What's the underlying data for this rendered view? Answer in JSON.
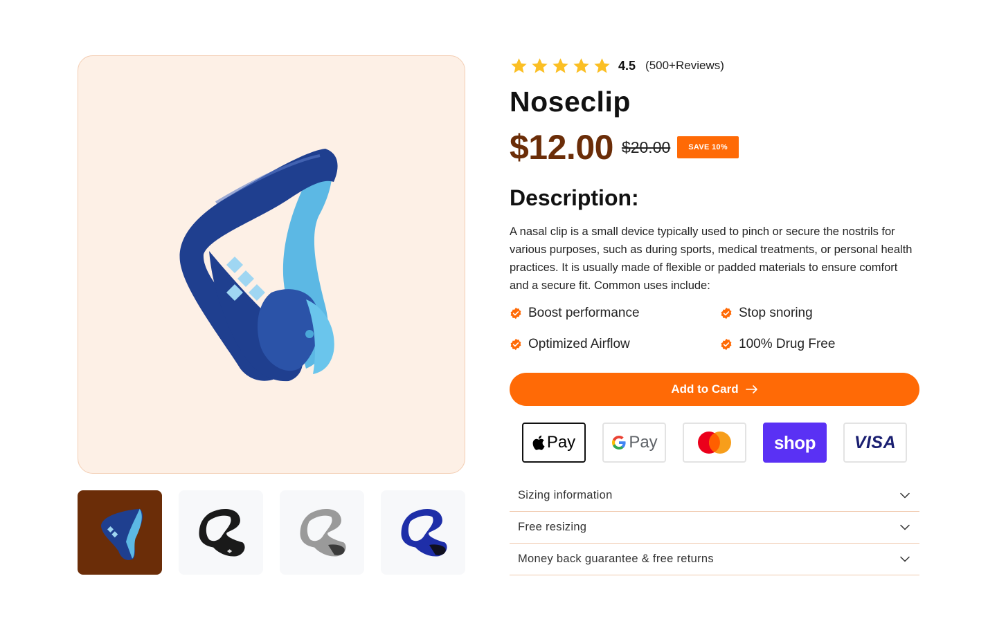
{
  "product": {
    "rating_value": "4.5",
    "rating_count": "(500+Reviews)",
    "stars": 5,
    "title": "Noseclip",
    "price": "$12.00",
    "old_price": "$20.00",
    "save_badge": "SAVE 10%"
  },
  "description": {
    "heading": "Description:",
    "text": "A nasal clip is a small device typically used to pinch or secure the nostrils for various purposes, such as during sports, medical treatments, or personal health practices. It is usually made of flexible or padded materials to ensure comfort and a secure fit. Common uses include:"
  },
  "features": [
    "Boost performance",
    "Stop snoring",
    "Optimized Airflow",
    "100% Drug Free"
  ],
  "cta": {
    "label": "Add to Card"
  },
  "payments": [
    {
      "name": "Apple Pay",
      "text": "Pay"
    },
    {
      "name": "Google Pay",
      "text": "Pay"
    },
    {
      "name": "Mastercard",
      "text": ""
    },
    {
      "name": "Shop Pay",
      "text": "shop"
    },
    {
      "name": "Visa",
      "text": "VISA"
    }
  ],
  "accordion": [
    "Sizing information",
    "Free resizing",
    "Money back guarantee & free returns"
  ],
  "gallery": {
    "thumbnails": [
      "blue-clip",
      "black-clip",
      "gray-clip",
      "navy-clip"
    ],
    "selected_index": 0
  },
  "colors": {
    "accent": "#ff6a06",
    "price": "#6b2d08",
    "hero_bg": "#fdf0e6",
    "star": "#fbbf24",
    "shop_pay": "#5a31f4",
    "visa": "#1a1f71"
  }
}
